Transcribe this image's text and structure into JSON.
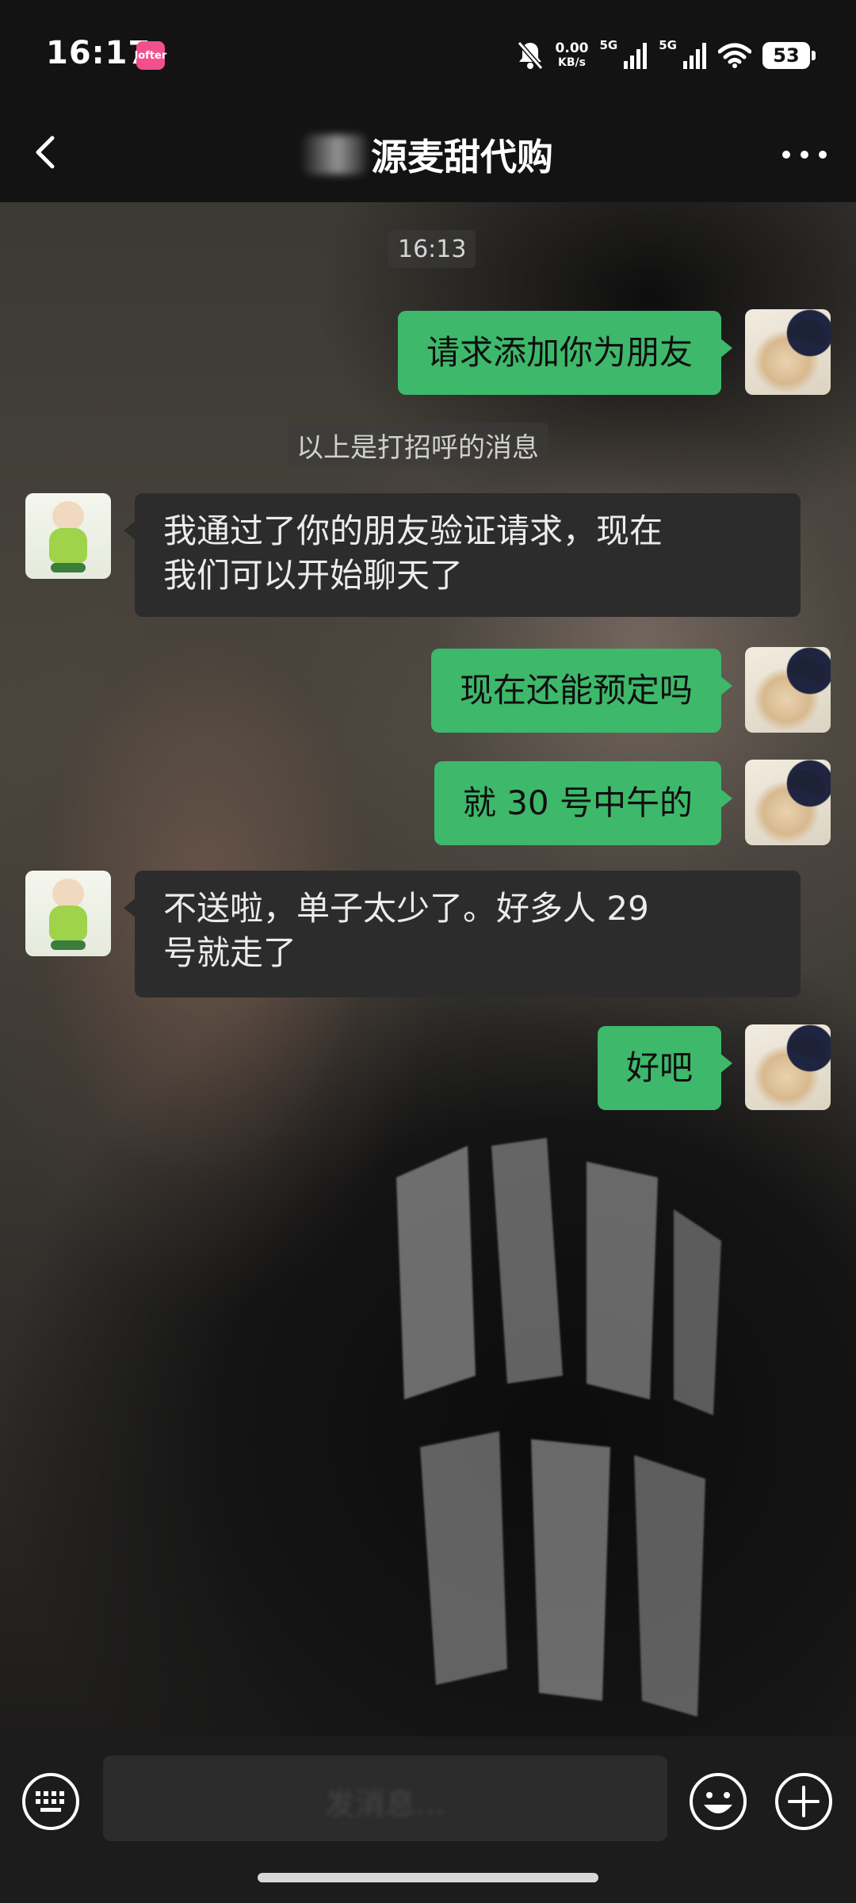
{
  "status_bar": {
    "time": "16:17",
    "app_icon_label": "lofter",
    "speed_value": "0.00",
    "speed_unit": "KB/s",
    "network_1": "5G",
    "network_2": "5G",
    "battery": "53",
    "icons": [
      "bell-muted-icon",
      "signal-icon",
      "wifi-icon",
      "battery-icon"
    ]
  },
  "header": {
    "title": "源麦甜代购",
    "back_icon": "chevron-left-icon",
    "more_icon": "more-dots-icon"
  },
  "chat": {
    "timestamp": "16:13",
    "system_message": "以上是打招呼的消息",
    "messages": [
      {
        "from": "me",
        "text": "请求添加你为朋友"
      },
      {
        "from": "them",
        "line1": "我通过了你的朋友验证请求，现在",
        "line2": "我们可以开始聊天了"
      },
      {
        "from": "me",
        "text": "现在还能预定吗"
      },
      {
        "from": "me",
        "text": "就 30 号中午的"
      },
      {
        "from": "them",
        "line1": "不送啦，单子太少了。好多人 29",
        "line2": "号就走了"
      },
      {
        "from": "me",
        "text": "好吧"
      }
    ]
  },
  "input_bar": {
    "placeholder": "发消息…",
    "icons": [
      "keyboard-icon",
      "emoji-icon",
      "plus-icon"
    ]
  },
  "colors": {
    "my_bubble": "#3eb86a",
    "their_bubble": "#2c2c2c",
    "bar_bg": "#131313",
    "input_bg": "#1c1c1c"
  }
}
